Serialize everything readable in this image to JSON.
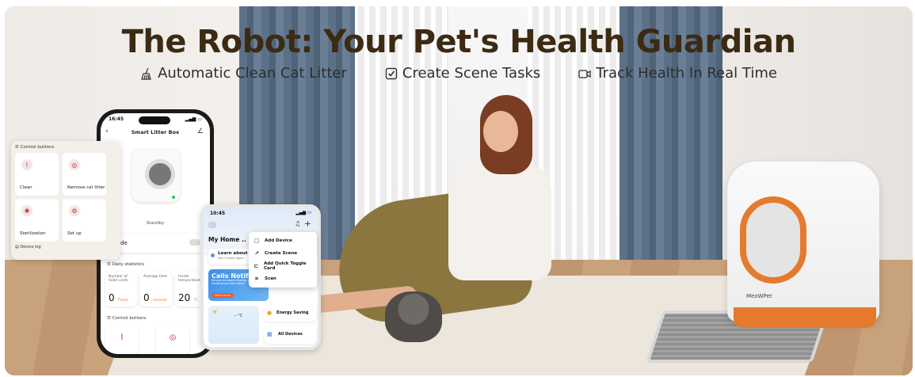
{
  "banner": {
    "title": "The Robot: Your Pet's Health Guardian",
    "features": [
      {
        "icon": "broom-icon",
        "label": "Automatic Clean Cat Litter"
      },
      {
        "icon": "checkbox-icon",
        "label": "Create Scene Tasks"
      },
      {
        "icon": "video-camera-icon",
        "label": "Track Health In Real Time"
      }
    ],
    "colors": {
      "title": "#3c2a12",
      "accent": "#e57a2e"
    }
  },
  "phone": {
    "time": "16:45",
    "title": "Smart Litter Box",
    "device_state": "Standby",
    "mode_label": "mode",
    "daily_label": "Daily statistics",
    "stats": [
      {
        "label": "Number of toilet visits",
        "value": "0",
        "unit": "Times"
      },
      {
        "label": "Average time",
        "value": "0",
        "unit": "seconds"
      },
      {
        "label": "Inside temperature",
        "value": "20",
        "unit": "°C"
      }
    ],
    "control_label": "Control buttons"
  },
  "control_card": {
    "title": "Control buttons",
    "items": [
      {
        "label": "Clean",
        "icon": "broom-icon"
      },
      {
        "label": "Remove cat litter",
        "icon": "remove-icon"
      },
      {
        "label": "Sterilization",
        "icon": "sterilize-icon"
      },
      {
        "label": "Set up",
        "icon": "gear-icon"
      }
    ],
    "footer": "Device log"
  },
  "phone2": {
    "time": "10:45",
    "home": "My Home ..",
    "learn_title": "Learn about th",
    "learn_sub": "Don't show again",
    "calls_title": "Calls Notific",
    "calls_sub": "No worries about missing calls, notifications from home",
    "calls_button": "Learn more",
    "temp": "-- °C",
    "energy": "Energy Saving",
    "all_devices": "All Devices"
  },
  "menu": {
    "items": [
      {
        "icon": "device-icon",
        "label": "Add Device"
      },
      {
        "icon": "scene-icon",
        "label": "Create Scene"
      },
      {
        "icon": "card-icon",
        "label": "Add Quick Toggle Card"
      },
      {
        "icon": "scan-icon",
        "label": "Scan"
      }
    ]
  },
  "robot": {
    "logo": "MeoWPet"
  }
}
